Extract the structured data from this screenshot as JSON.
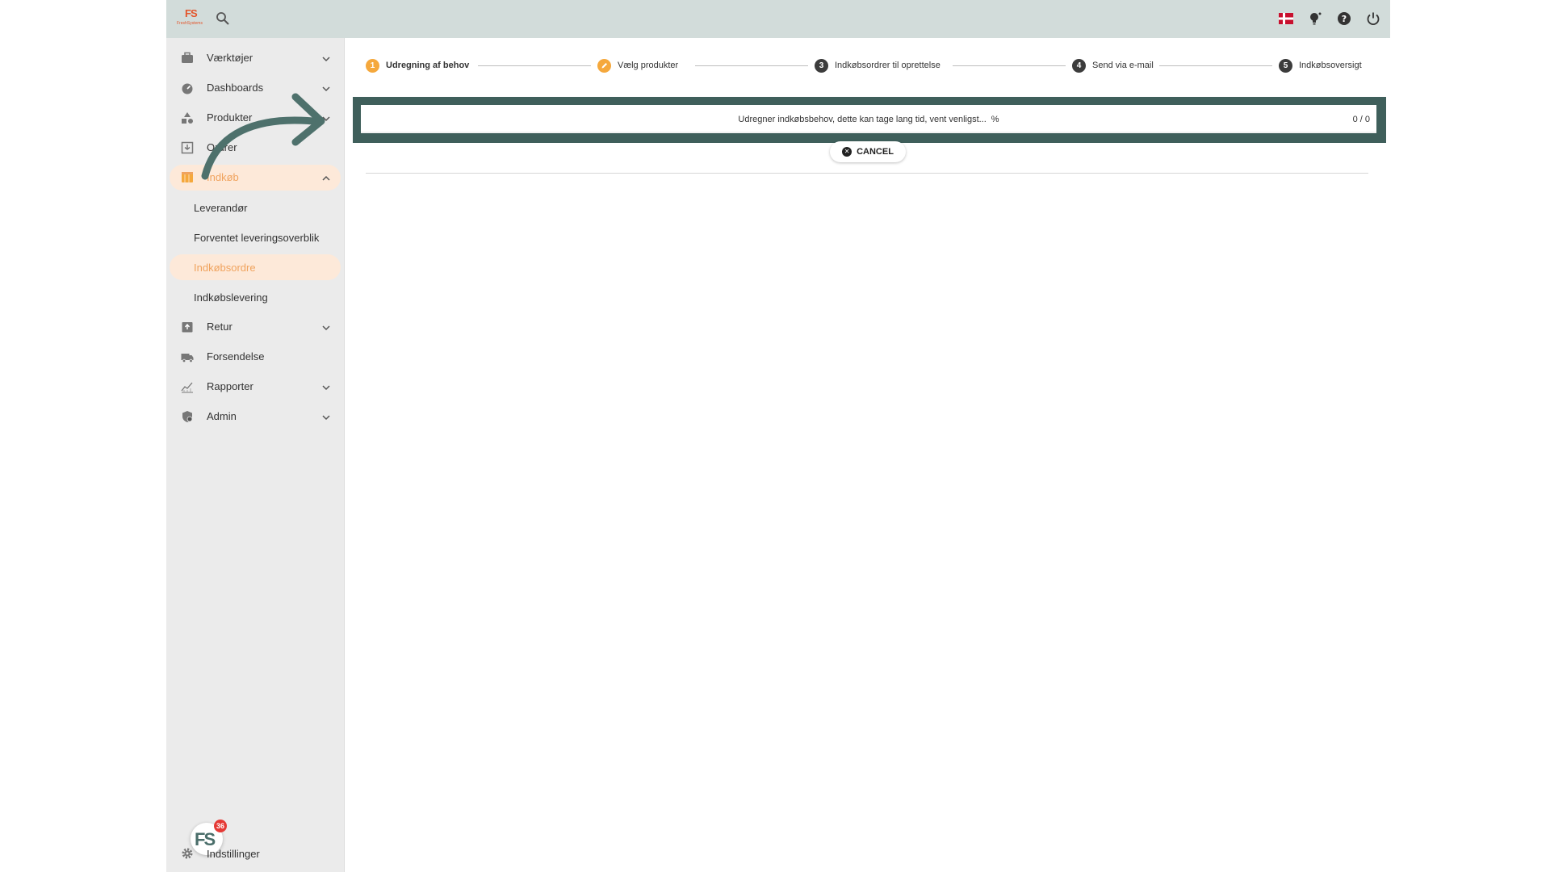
{
  "topbar": {
    "logo_text": "FS",
    "logo_tagline": "FreshSystems",
    "icons": [
      "search-icon",
      "danish-flag-icon",
      "lightbulb-icon",
      "help-icon",
      "power-icon"
    ]
  },
  "sidebar": {
    "items": [
      {
        "label": "Værktøjer",
        "icon": "toolbox-icon"
      },
      {
        "label": "Dashboards",
        "icon": "gauge-icon"
      },
      {
        "label": "Produkter",
        "icon": "shapes-icon"
      },
      {
        "label": "Ordrer",
        "icon": "inbox-icon"
      },
      {
        "label": "Indkøb",
        "icon": "store-icon"
      },
      {
        "label": "Retur",
        "icon": "return-box-icon"
      },
      {
        "label": "Forsendelse",
        "icon": "truck-icon"
      },
      {
        "label": "Rapporter",
        "icon": "chart-icon"
      },
      {
        "label": "Admin",
        "icon": "shield-icon"
      }
    ],
    "sub_items": [
      "Leverandør",
      "Forventet leveringsoverblik",
      "Indkøbsordre",
      "Indkøbslevering"
    ],
    "settings_label": "Indstillinger",
    "badge_text": "FS",
    "badge_count": "36"
  },
  "stepper": {
    "steps": [
      {
        "number": "1",
        "label": "Udregning af behov"
      },
      {
        "number": "",
        "label": "Vælg produkter"
      },
      {
        "number": "3",
        "label": "Indkøbsordrer til oprettelse"
      },
      {
        "number": "4",
        "label": "Send via e-mail"
      },
      {
        "number": "5",
        "label": "Indkøbsoversigt"
      }
    ]
  },
  "progress": {
    "message": "Udregner indkøbsbehov, dette kan tage lang tid, vent venligst...",
    "percent_sign": "%",
    "count": "0 / 0",
    "fraction": 0
  },
  "cancel_label": "CANCEL",
  "colors": {
    "topbar": "#d2dcda",
    "accent": "#f5a83c",
    "highlight_frame": "#3f5f5b",
    "active_bg": "#fde9d9"
  }
}
